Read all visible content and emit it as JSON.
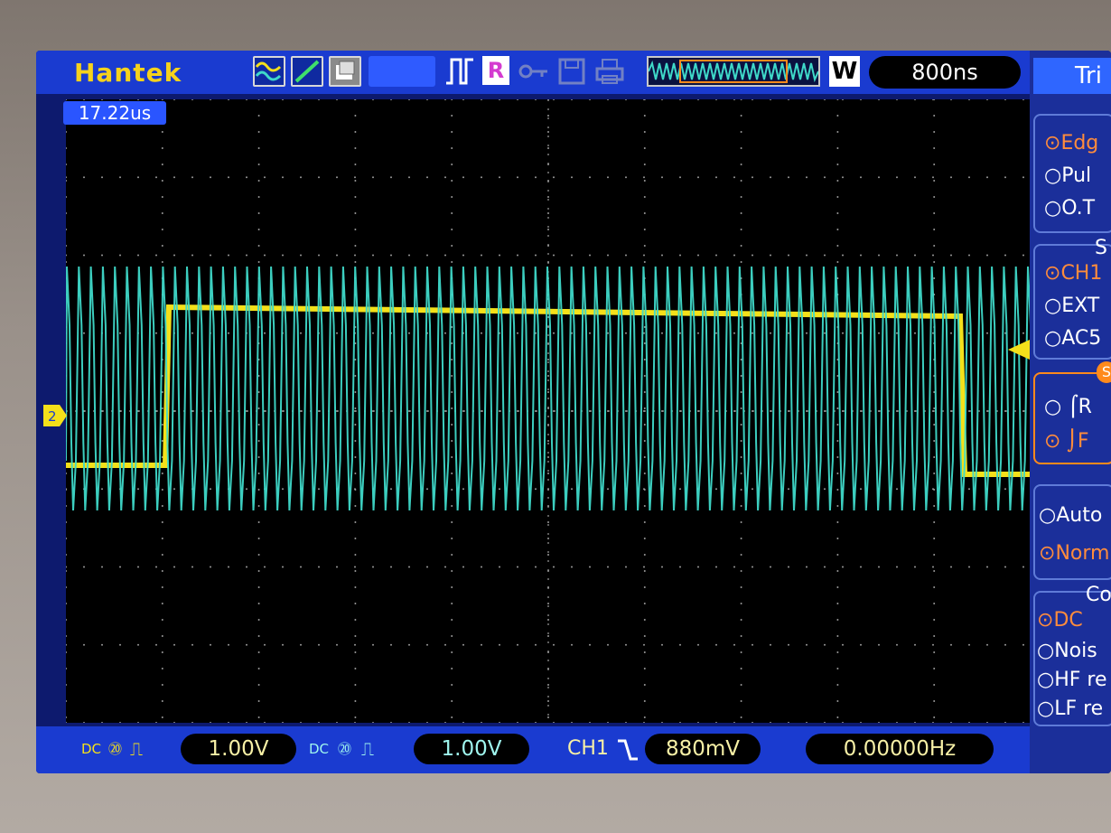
{
  "top": {
    "brand": "Hantek",
    "record_badge": "R",
    "wbadge": "W",
    "timebase": "800ns",
    "time_offset": "17.22us"
  },
  "right_panel": {
    "title": "Tri",
    "type_options": [
      {
        "label": "Edg",
        "selected": true
      },
      {
        "label": "Pul",
        "selected": false
      },
      {
        "label": "O.T",
        "selected": false
      }
    ],
    "source_header": "S",
    "source_options": [
      {
        "label": "CH1",
        "selected": true
      },
      {
        "label": "EXT",
        "selected": false
      },
      {
        "label": "AC5",
        "selected": false
      }
    ],
    "slope_badge": "S",
    "slope_options": [
      {
        "label": "R",
        "selected": false
      },
      {
        "label": "F",
        "selected": true
      }
    ],
    "mode_options": [
      {
        "label": "Auto",
        "selected": false
      },
      {
        "label": "Norm",
        "selected": true
      }
    ],
    "coupling_header": "Co",
    "coupling_options": [
      {
        "label": "DC",
        "selected": true
      },
      {
        "label": "Nois",
        "selected": false
      },
      {
        "label": "HF re",
        "selected": false
      },
      {
        "label": "LF re",
        "selected": false
      }
    ]
  },
  "bottom": {
    "ch1_scale": "1.00V",
    "ch2_scale": "1.00V",
    "trigger_source": "CH1",
    "trigger_level": "880mV",
    "frequency": "0.00000Hz",
    "coupling_icon": "DC",
    "bw_icon": "20"
  },
  "colors": {
    "ch1": "#f4e01a",
    "ch2": "#3fd9c9",
    "panel_blue": "#1a3bd0",
    "accent_orange": "#ff8a1c"
  }
}
